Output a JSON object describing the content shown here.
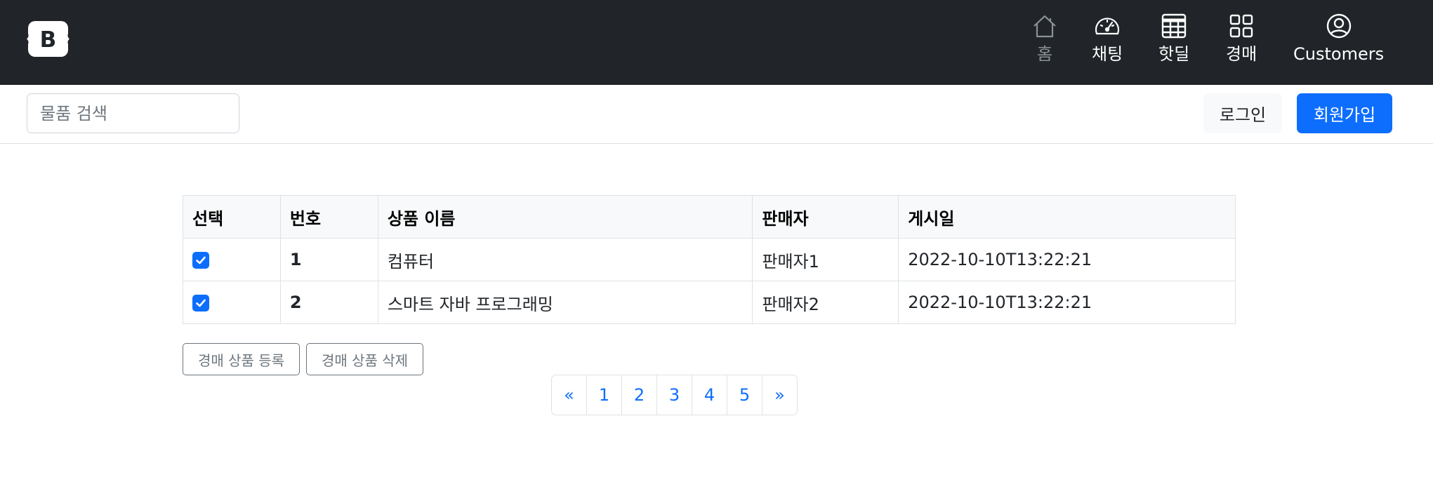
{
  "navbar": {
    "brand_letter": "B",
    "items": [
      {
        "label": "홈",
        "icon": "house-icon"
      },
      {
        "label": "채팅",
        "icon": "speedometer-icon"
      },
      {
        "label": "핫딜",
        "icon": "table-icon"
      },
      {
        "label": "경매",
        "icon": "grid-icon"
      },
      {
        "label": "Customers",
        "icon": "person-circle-icon"
      }
    ]
  },
  "subheader": {
    "search_placeholder": "물품 검색",
    "login_label": "로그인",
    "signup_label": "회원가입"
  },
  "table": {
    "headers": [
      "선택",
      "번호",
      "상품 이름",
      "판매자",
      "게시일"
    ],
    "rows": [
      {
        "checked": true,
        "num": "1",
        "name": "컴퓨터",
        "seller": "판매자1",
        "date": "2022-10-10T13:22:21"
      },
      {
        "checked": true,
        "num": "2",
        "name": "스마트 자바 프로그래밍",
        "seller": "판매자2",
        "date": "2022-10-10T13:22:21"
      }
    ]
  },
  "actions": {
    "register_label": "경매 상품 등록",
    "delete_label": "경매 상품 삭제"
  },
  "pagination": {
    "prev": "«",
    "pages": [
      "1",
      "2",
      "3",
      "4",
      "5"
    ],
    "next": "»"
  },
  "colors": {
    "navbar_bg": "#212529",
    "primary": "#0d6efd",
    "muted": "#8c9196"
  }
}
